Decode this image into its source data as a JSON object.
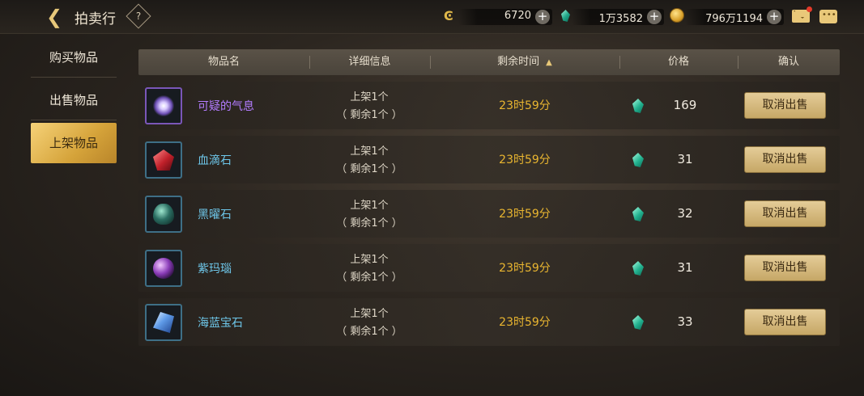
{
  "header": {
    "title": "拍卖行",
    "help_label": "?"
  },
  "resources": [
    {
      "icon": "crystal-coin-icon",
      "value": "6720"
    },
    {
      "icon": "green-gem-icon",
      "value": "1万3582"
    },
    {
      "icon": "gold-coin-icon",
      "value": "796万1194"
    }
  ],
  "sidebar": {
    "items": [
      {
        "label": "购买物品",
        "active": false
      },
      {
        "label": "出售物品",
        "active": false
      },
      {
        "label": "上架物品",
        "active": true
      }
    ]
  },
  "table": {
    "columns": [
      "物品名",
      "详细信息",
      "剩余时间",
      "价格",
      "确认"
    ],
    "sort_indicator": "▲",
    "rows": [
      {
        "name": "可疑的气息",
        "detail_line1": "上架1个",
        "detail_line2": "（ 剩余1个 ）",
        "time": "23时59分",
        "price": "169",
        "button": "取消出售",
        "icon": "suspicious-aura-icon"
      },
      {
        "name": "血滴石",
        "detail_line1": "上架1个",
        "detail_line2": "（ 剩余1个 ）",
        "time": "23时59分",
        "price": "31",
        "button": "取消出售",
        "icon": "bloodstone-icon"
      },
      {
        "name": "黑曜石",
        "detail_line1": "上架1个",
        "detail_line2": "（ 剩余1个 ）",
        "time": "23时59分",
        "price": "32",
        "button": "取消出售",
        "icon": "obsidian-icon"
      },
      {
        "name": "紫玛瑙",
        "detail_line1": "上架1个",
        "detail_line2": "（ 剩余1个 ）",
        "time": "23时59分",
        "price": "31",
        "button": "取消出售",
        "icon": "purple-agate-icon"
      },
      {
        "name": "海蓝宝石",
        "detail_line1": "上架1个",
        "detail_line2": "（ 剩余1个 ）",
        "time": "23时59分",
        "price": "33",
        "button": "取消出售",
        "icon": "aquamarine-icon"
      }
    ]
  },
  "colors": {
    "accent_gold": "#d5a33a",
    "time_text": "#eab630",
    "item_name_blue": "#6ec7ea",
    "item_name_purple": "#b37cff"
  }
}
